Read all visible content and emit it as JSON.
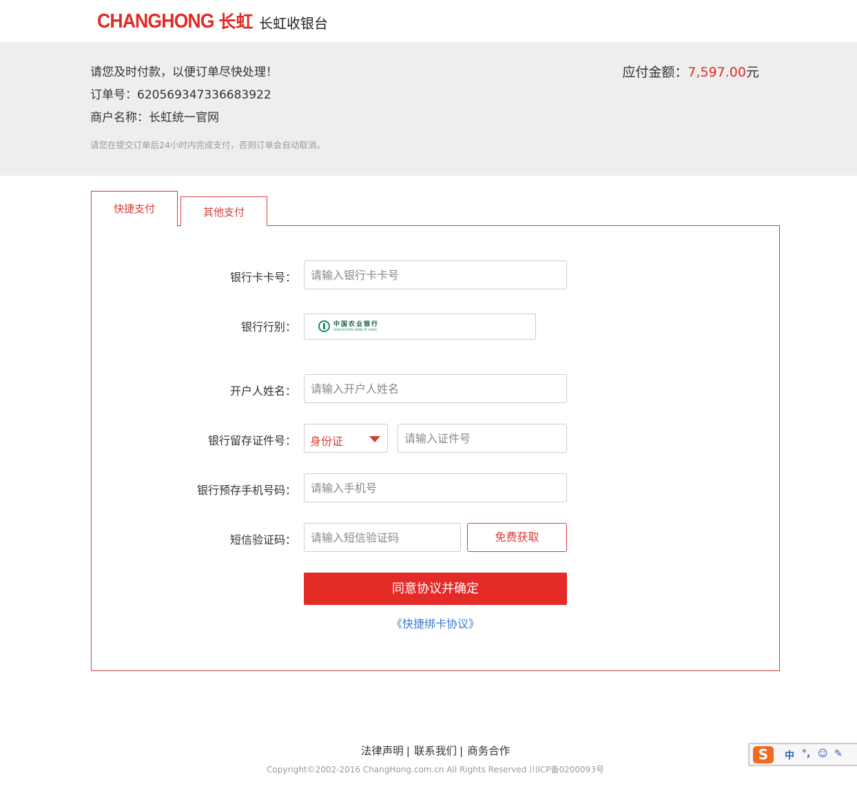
{
  "header": {
    "logo_en": "CHANGHONG",
    "logo_cn": "长虹",
    "title": "长虹收银台"
  },
  "order": {
    "prompt": "请您及时付款，以便订单尽快处理！",
    "order_no": "订单号：620569347336683922",
    "merchant": "商户名称：长虹统一官网",
    "note": "请您在提交订单后24小时内完成支付，否则订单会自动取消。",
    "amount_label": "应付金额：",
    "amount_value": "7,597.00",
    "amount_unit": "元"
  },
  "tabs": [
    {
      "label": "快捷支付",
      "active": true
    },
    {
      "label": "其他支付",
      "active": false
    }
  ],
  "form": {
    "card_no": {
      "label": "银行卡卡号：",
      "placeholder": "请输入银行卡卡号"
    },
    "bank": {
      "label": "银行行别：",
      "selected_cn": "中国农业银行",
      "selected_en": "AGRICULTURAL BANK OF CHINA"
    },
    "holder": {
      "label": "开户人姓名：",
      "placeholder": "请输入开户人姓名"
    },
    "id": {
      "label": "银行留存证件号：",
      "type_selected": "身份证",
      "placeholder": "请输入证件号"
    },
    "phone": {
      "label": "银行预存手机号码：",
      "placeholder": "请输入手机号"
    },
    "sms": {
      "label": "短信验证码：",
      "placeholder": "请输入短信验证码",
      "button": "免费获取"
    },
    "submit": "同意协议并确定",
    "protocol": "《快捷绑卡协议》"
  },
  "footer": {
    "links": [
      "法律声明",
      "联系我们",
      "商务合作"
    ],
    "separator": "|",
    "copyright": "Copyright©2002-2016 ChangHong.com.cn All Rights Reserved 川ICP备0200093号"
  },
  "ime": {
    "logo": "S",
    "items": [
      "中",
      "°,",
      "☺",
      "✎"
    ]
  },
  "colors": {
    "brand_red": "#e02a26",
    "button_red": "#e52b28",
    "link_blue": "#3a7ad0",
    "info_bg": "#eeeeee"
  }
}
